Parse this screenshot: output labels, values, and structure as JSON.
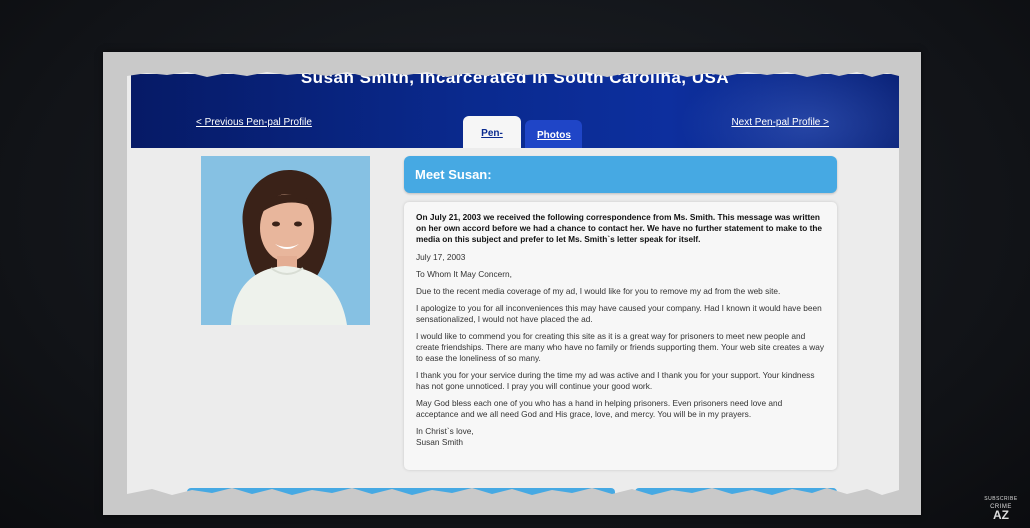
{
  "header": {
    "title": "Susan Smith, Incarcerated in South Carolina, USA",
    "prev_link": "< Previous Pen-pal Profile",
    "next_link": "Next Pen-pal Profile >"
  },
  "tabs": [
    {
      "label": "Pen-pal",
      "active": true
    },
    {
      "label": "Photos",
      "active": false
    }
  ],
  "profile": {
    "heading": "Meet Susan:"
  },
  "letter": {
    "intro": "On July 21, 2003 we received the following correspondence from Ms. Smith. This message was written on her own accord before we had a chance to contact her. We have no further statement to make to the media on this subject and prefer to let Ms. Smith`s letter speak for itself.",
    "date": "July 17, 2003",
    "salutation": "To Whom It May Concern,",
    "p1": "Due to the recent media coverage of my ad, I would like for you to remove my ad from the web site.",
    "p2": "I apologize to you for all inconveniences this may have caused your company. Had I known it would have been sensationalized, I would not have placed the ad.",
    "p3": "I would like to commend you for creating this site as it is a great way for prisoners to meet new people and create friendships. There are many who have no family or friends supporting them. Your web site creates a way to ease the loneliness of so many.",
    "p4": "I thank you for your service during the time my ad was active and I thank you for your support. Your kindness has not gone unnoticed. I pray you will continue your good work.",
    "p5": "May God bless each one of you who has a hand in helping prisoners. Even prisoners need love and acceptance and we all need God and His grace, love, and mercy. You will be in my prayers.",
    "closing": "In Christ`s love,",
    "signature": "Susan Smith"
  },
  "watermark": {
    "subscribe": "SUBSCRIBE",
    "channel": "CRIME",
    "logo": "AZ"
  },
  "colors": {
    "header_blue": "#0a2a8f",
    "accent_blue": "#46a9e3"
  }
}
